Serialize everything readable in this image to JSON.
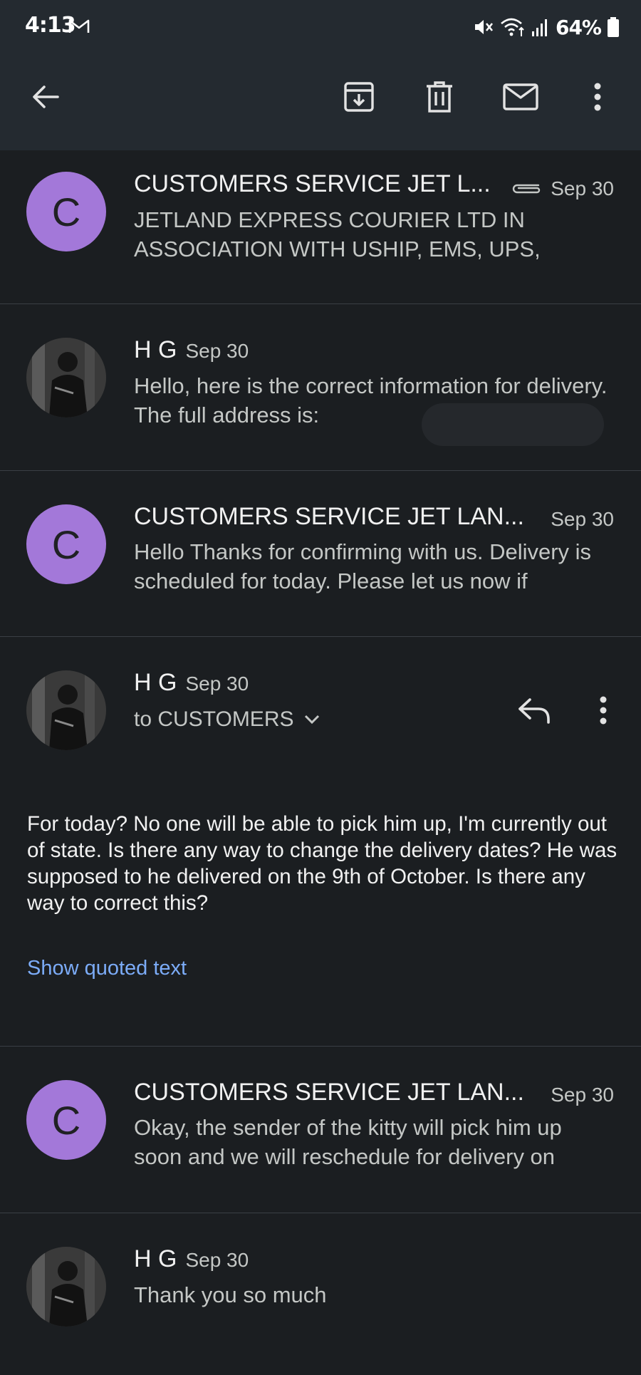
{
  "status_bar": {
    "time": "4:13",
    "battery": "64%",
    "icons": [
      "gmail-icon",
      "mute-icon",
      "wifi-icon",
      "signal-icon",
      "battery-icon"
    ]
  },
  "app_bar": {
    "icons": [
      "back-arrow-icon",
      "archive-icon",
      "trash-icon",
      "mark-unread-icon",
      "more-vert-icon"
    ]
  },
  "messages": [
    {
      "sender": "CUSTOMERS SERVICE JET L...",
      "date": "Sep 30",
      "avatar_letter": "C",
      "has_attachment": true,
      "snippet": "JETLAND EXPRESS COURIER LTD IN ASSOCIATION WITH USHIP, EMS, UPS,"
    },
    {
      "sender": "H G",
      "date": "Sep 30",
      "snippet": "Hello, here is the correct information for delivery. The full address is:"
    },
    {
      "sender": "CUSTOMERS SERVICE JET LAN...",
      "date": "Sep 30",
      "avatar_letter": "C",
      "snippet": "Hello Thanks for confirming with us. Delivery is scheduled for today. Please let us now if"
    },
    {
      "sender": "H G",
      "date": "Sep 30",
      "recipient": "to CUSTOMERS",
      "body": "For today? No one will be able to pick him up, I'm currently out of state. Is there any way to change the delivery dates? He was supposed to he delivered on the 9th of October. Is there any way to correct this?",
      "show_quoted": "Show quoted text"
    },
    {
      "sender": "CUSTOMERS SERVICE JET LAN...",
      "date": "Sep 30",
      "avatar_letter": "C",
      "snippet": "Okay, the sender of the kitty will pick him up soon and we will reschedule for delivery on"
    },
    {
      "sender": "H G",
      "date": "Sep 30",
      "snippet": "Thank you so much"
    }
  ],
  "colors": {
    "header_bg": "#242a30",
    "page_bg": "#1b1e21",
    "avatar_purple": "#a378d9",
    "link_blue": "#7cacf8"
  }
}
